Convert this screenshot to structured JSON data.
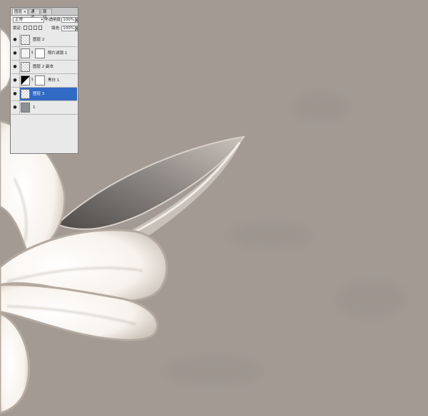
{
  "panel": {
    "tabs": [
      {
        "label": "图层",
        "close": "×"
      },
      {
        "label": "通道"
      },
      {
        "label": "路径"
      }
    ],
    "blend_mode": "正常",
    "opacity_label": "不透明度:",
    "opacity_value": "100%",
    "lock_label": "锁定:",
    "fill_label": "填充:",
    "fill_value": "100%",
    "layers": [
      {
        "name": "图层 2",
        "thumb": "transparent",
        "has_mask": false,
        "selected": false
      },
      {
        "name": "照片滤镜 1",
        "thumb": "adjustment",
        "has_mask": true,
        "selected": false
      },
      {
        "name": "图层 2 副本",
        "thumb": "transparent",
        "has_mask": false,
        "selected": false
      },
      {
        "name": "黑白 1",
        "thumb": "black-white",
        "has_mask": true,
        "selected": false
      },
      {
        "name": "图层 3",
        "thumb": "transparent",
        "has_mask": false,
        "selected": true
      },
      {
        "name": "1",
        "thumb": "gray",
        "has_mask": false,
        "selected": false
      }
    ]
  },
  "colors": {
    "canvas_background": "#a39a94",
    "selection": "#316ac5",
    "panel_background": "#e9e9e9"
  },
  "icons": {
    "visibility": "eye-icon",
    "link": "chain-link-icon",
    "dropdown": "chevron-down-icon",
    "lock": "lock-icon"
  }
}
